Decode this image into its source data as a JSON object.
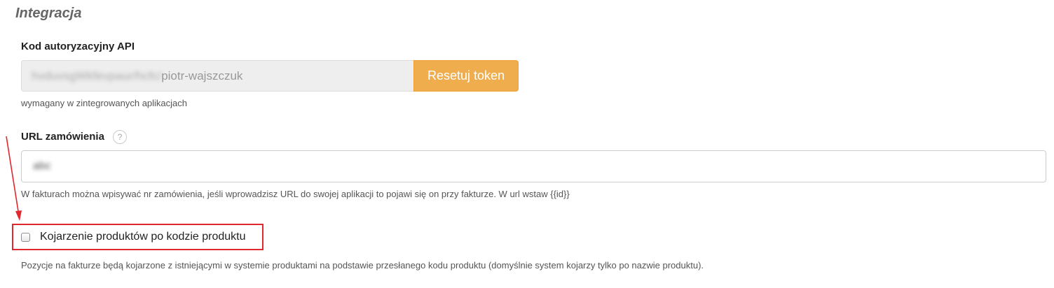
{
  "section": {
    "title": "Integracja"
  },
  "api_token": {
    "label": "Kod autoryzacyjny API",
    "value_obscured": "hvduvsgWkfevpaur/hcfc/",
    "value_visible": "piotr-wajszczuk",
    "reset_button_label": "Resetuj token",
    "help": "wymagany w zintegrowanych aplikacjach"
  },
  "order_url": {
    "label": "URL zamówienia",
    "info_icon": "question-mark-icon",
    "info_glyph": "?",
    "value": "abc",
    "help": "W fakturach można wpisywać nr zamówienia, jeśli wprowadzisz URL do swojej aplikacji to pojawi się on przy fakturze. W url wstaw {{id}}"
  },
  "product_matching": {
    "label": "Kojarzenie produktów po kodzie produktu",
    "checked": false,
    "help": "Pozycje na fakturze będą kojarzone z istniejącymi w systemie produktami na podstawie przesłanego kodu produktu (domyślnie system kojarzy tylko po nazwie produktu)."
  },
  "colors": {
    "accent_button": "#f0ad4e",
    "highlight_annotation": "#e0282e"
  }
}
